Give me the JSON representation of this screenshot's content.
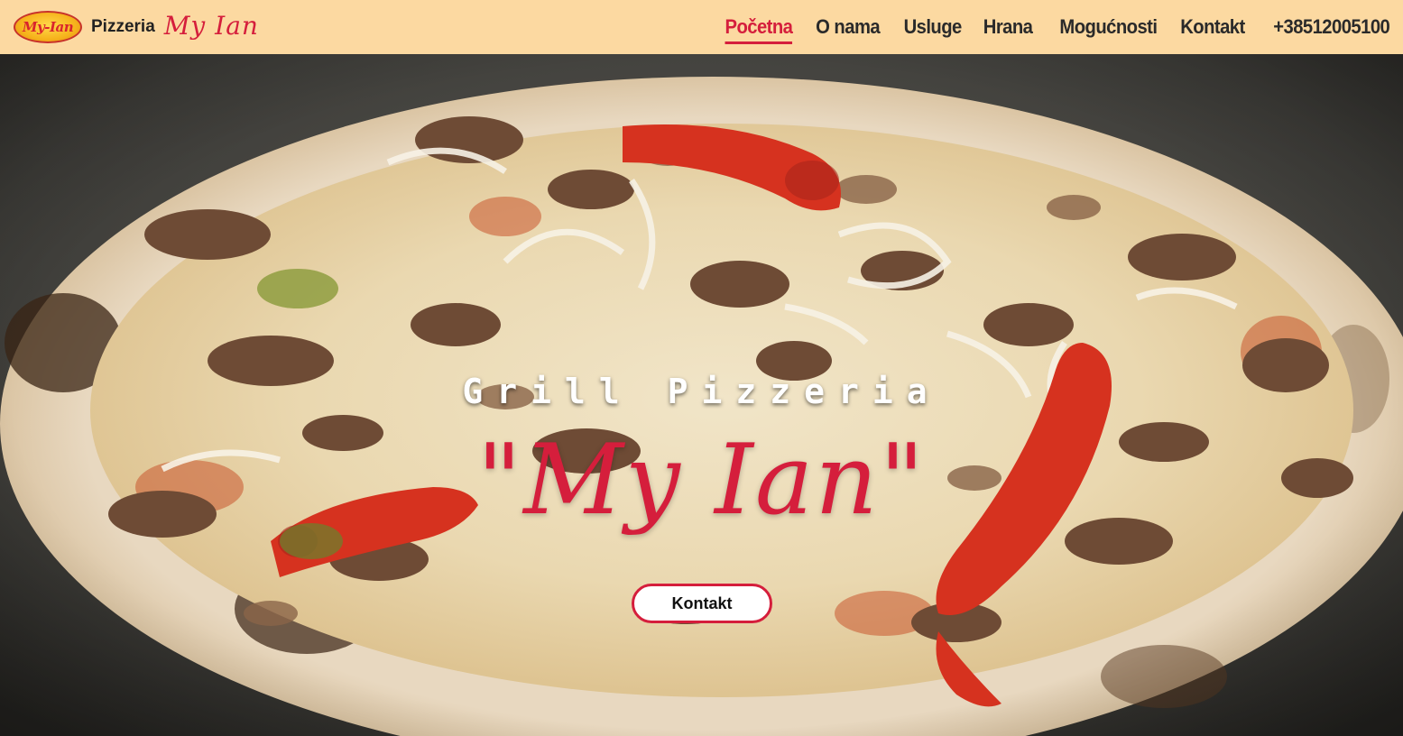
{
  "brand": {
    "logo_text": "My-Ian",
    "word": "Pizzeria",
    "script": "My Ian"
  },
  "nav": {
    "items": [
      {
        "label": "Početna",
        "active": true
      },
      {
        "label": "O nama"
      },
      {
        "label": "Usluge"
      },
      {
        "label": "Hrana"
      },
      {
        "label": "Mogućnosti"
      },
      {
        "label": "Kontakt"
      },
      {
        "label": "+38512005100"
      }
    ]
  },
  "hero": {
    "subtitle": "Grill Pizzeria",
    "title": "\"My Ian\"",
    "cta_label": "Kontakt"
  },
  "colors": {
    "header_bg": "#fcd9a1",
    "accent": "#d51e3c",
    "nav_text": "#2a2a2a"
  }
}
